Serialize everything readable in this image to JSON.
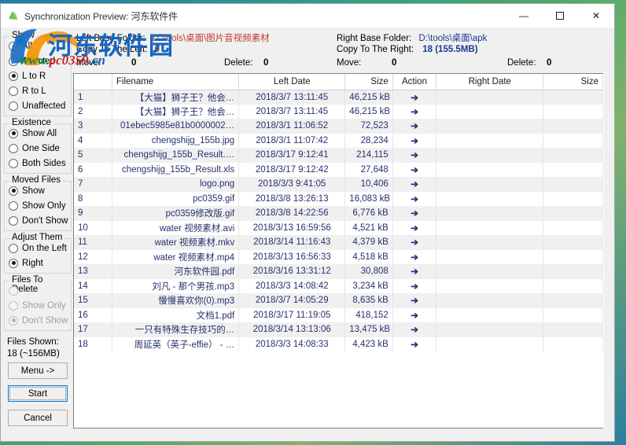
{
  "window": {
    "title": "Synchronization Preview: 河东软件件",
    "minimize_label": "—",
    "maximize_label": "❐",
    "close_label": "✕"
  },
  "watermark": {
    "cn": "河东软件园",
    "url_green": "www.",
    "url_red": "pc0359",
    "url_blue": ".cn"
  },
  "sidebar": {
    "groups": [
      {
        "title": "Show",
        "disabled": false,
        "options": [
          {
            "label": "All",
            "mnemonic": "A",
            "checked": false
          },
          {
            "label": "Affected",
            "mnemonic": "f",
            "checked": false
          },
          {
            "label": "L to R",
            "mnemonic": "L",
            "checked": true
          },
          {
            "label": "R to L",
            "mnemonic": "R",
            "checked": false
          },
          {
            "label": "Unaffected",
            "mnemonic": "U",
            "checked": false
          }
        ]
      },
      {
        "title": "Existence",
        "disabled": false,
        "options": [
          {
            "label": "Show All",
            "mnemonic": "w",
            "checked": true
          },
          {
            "label": "One Side",
            "mnemonic": "O",
            "checked": false
          },
          {
            "label": "Both Sides",
            "mnemonic": "B",
            "checked": false
          }
        ]
      },
      {
        "title": "Moved Files",
        "disabled": false,
        "options": [
          {
            "label": "Show",
            "mnemonic": "h",
            "checked": true
          },
          {
            "label": "Show Only",
            "mnemonic": "O",
            "checked": false
          },
          {
            "label": "Don't Show",
            "mnemonic": "n",
            "checked": false
          }
        ]
      },
      {
        "title": "Adjust Them",
        "disabled": false,
        "options": [
          {
            "label": "On the Left",
            "mnemonic": "",
            "checked": false
          },
          {
            "label": "Right",
            "mnemonic": "i",
            "checked": true
          }
        ]
      },
      {
        "title": "Files To Delete",
        "disabled": true,
        "options": [
          {
            "label": "Show",
            "mnemonic": "h",
            "checked": false
          },
          {
            "label": "Show Only",
            "mnemonic": "O",
            "checked": false
          },
          {
            "label": "Don't Show",
            "mnemonic": "n",
            "checked": true
          }
        ]
      }
    ],
    "files_shown_label": "Files Shown:",
    "files_shown_value": "18 (~156MB)",
    "menu_button": "Menu ->",
    "start_button": "Start",
    "cancel_button": "Cancel"
  },
  "info": {
    "left_base_folder_label": "Left Base Folder:",
    "left_base_folder_value": "D:\\tools\\桌面\\图片音视频素材",
    "copy_to_left_label": "Copy To The Left:",
    "copy_to_left_value": "0",
    "left_move_label": "Move:",
    "left_move_value": "0",
    "left_delete_label": "Delete:",
    "left_delete_value": "0",
    "right_base_folder_label": "Right Base Folder:",
    "right_base_folder_value": "D:\\tools\\桌面\\apk",
    "copy_to_right_label": "Copy To The Right:",
    "copy_to_right_value": "18 (155.5MB)",
    "right_move_label": "Move:",
    "right_move_value": "0",
    "right_delete_label": "Delete:",
    "right_delete_value": "0"
  },
  "table": {
    "columns": [
      "",
      "Filename",
      "Left Date",
      "Size",
      "Action",
      "Right Date",
      "Size"
    ],
    "action_glyph": "➔",
    "rows": [
      {
        "n": "1",
        "name": "【大猫】狮子王？他会…",
        "ldate": "2018/3/7 13:11:45",
        "lsize": "46,215 kB",
        "act": "➔",
        "rdate": "",
        "rsize": ""
      },
      {
        "n": "2",
        "name": "【大猫】狮子王？他会…",
        "ldate": "2018/3/7 13:11:45",
        "lsize": "46,215 kB",
        "act": "➔",
        "rdate": "",
        "rsize": ""
      },
      {
        "n": "3",
        "name": "01ebec5985e81b0000002…",
        "ldate": "2018/3/1 11:06:52",
        "lsize": "72,523",
        "act": "➔",
        "rdate": "",
        "rsize": ""
      },
      {
        "n": "4",
        "name": "chengshijg_155b.jpg",
        "ldate": "2018/3/1 11:07:42",
        "lsize": "28,234",
        "act": "➔",
        "rdate": "",
        "rsize": ""
      },
      {
        "n": "5",
        "name": "chengshijg_155b_Result.…",
        "ldate": "2018/3/17 9:12:41",
        "lsize": "214,115",
        "act": "➔",
        "rdate": "",
        "rsize": ""
      },
      {
        "n": "6",
        "name": "chengshijg_155b_Result.xls",
        "ldate": "2018/3/17 9:12:42",
        "lsize": "27,648",
        "act": "➔",
        "rdate": "",
        "rsize": ""
      },
      {
        "n": "7",
        "name": "logo.png",
        "ldate": "2018/3/3 9:41:05",
        "lsize": "10,406",
        "act": "➔",
        "rdate": "",
        "rsize": ""
      },
      {
        "n": "8",
        "name": "pc0359.gif",
        "ldate": "2018/3/8 13:26:13",
        "lsize": "16,083 kB",
        "act": "➔",
        "rdate": "",
        "rsize": ""
      },
      {
        "n": "9",
        "name": "pc0359修改版.gif",
        "ldate": "2018/3/8 14:22:56",
        "lsize": "6,776 kB",
        "act": "➔",
        "rdate": "",
        "rsize": ""
      },
      {
        "n": "10",
        "name": "water 视频素材.avi",
        "ldate": "2018/3/13 16:59:56",
        "lsize": "4,521 kB",
        "act": "➔",
        "rdate": "",
        "rsize": ""
      },
      {
        "n": "11",
        "name": "water 视频素材.mkv",
        "ldate": "2018/3/14 11:16:43",
        "lsize": "4,379 kB",
        "act": "➔",
        "rdate": "",
        "rsize": ""
      },
      {
        "n": "12",
        "name": "water 视频素材.mp4",
        "ldate": "2018/3/13 16:56:33",
        "lsize": "4,518 kB",
        "act": "➔",
        "rdate": "",
        "rsize": ""
      },
      {
        "n": "13",
        "name": "河东软件园.pdf",
        "ldate": "2018/3/16 13:31:12",
        "lsize": "30,808",
        "act": "➔",
        "rdate": "",
        "rsize": ""
      },
      {
        "n": "14",
        "name": "刘凡 - 那个男孩.mp3",
        "ldate": "2018/3/3 14:08:42",
        "lsize": "3,234 kB",
        "act": "➔",
        "rdate": "",
        "rsize": ""
      },
      {
        "n": "15",
        "name": "慢慢喜欢你(0).mp3",
        "ldate": "2018/3/7 14:05:29",
        "lsize": "8,635 kB",
        "act": "➔",
        "rdate": "",
        "rsize": ""
      },
      {
        "n": "16",
        "name": "文档1.pdf",
        "ldate": "2018/3/17 11:19:05",
        "lsize": "418,152",
        "act": "➔",
        "rdate": "",
        "rsize": ""
      },
      {
        "n": "17",
        "name": "一只有特殊生存技巧的…",
        "ldate": "2018/3/14 13:13:06",
        "lsize": "13,475 kB",
        "act": "➔",
        "rdate": "",
        "rsize": ""
      },
      {
        "n": "18",
        "name": "周延英（英子-effie） - …",
        "ldate": "2018/3/3 14:08:33",
        "lsize": "4,423 kB",
        "act": "➔",
        "rdate": "",
        "rsize": ""
      }
    ]
  }
}
